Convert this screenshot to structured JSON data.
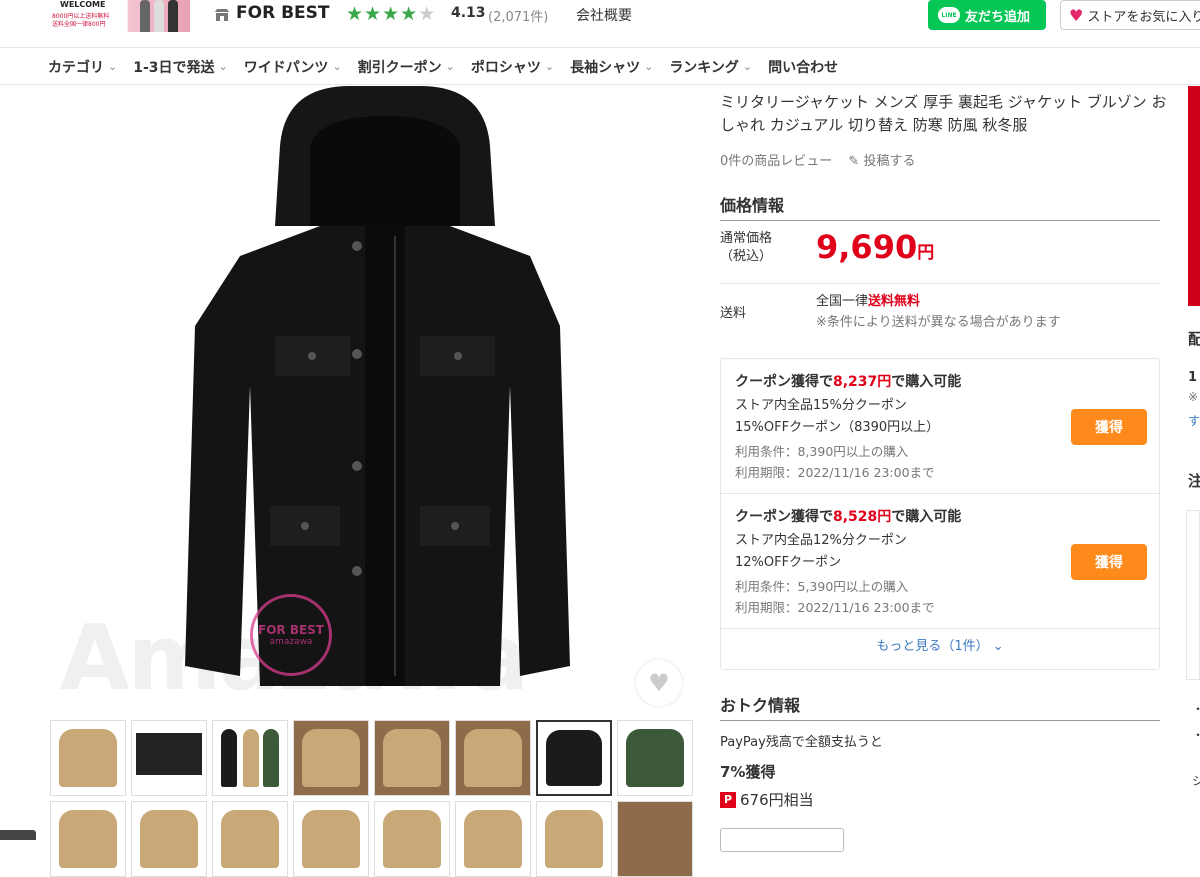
{
  "header": {
    "banner": {
      "title": "WELCOME",
      "line1": "8000円以上送料無料",
      "line2": "送料全国一律800円"
    },
    "store_name": "FOR BEST",
    "rating": "4.13",
    "rating_count": "(2,071件)",
    "rating_stars": 4,
    "company_link": "会社概要",
    "line_button": "友だち追加",
    "line_icon_text": "LINE",
    "fav_button": "ストアをお気に入り"
  },
  "nav": {
    "items": [
      "カテゴリ",
      "1-3日で発送",
      "ワイドパンツ",
      "割引クーポン",
      "ポロシャツ",
      "長袖シャツ",
      "ランキング",
      "問い合わせ"
    ]
  },
  "image": {
    "watermark": "Amazawa",
    "stamp_brand": "FOR BEST",
    "stamp_sub": "amazawa"
  },
  "product": {
    "title": "ミリタリージャケット メンズ 厚手 裏起毛 ジャケット ブルゾン おしゃれ カジュアル 切り替え 防寒 防風 秋冬服",
    "reviews": "0件の商品レビュー",
    "post_review": "投稿する"
  },
  "price": {
    "heading": "価格情報",
    "label_line1": "通常価格",
    "label_line2": "（税込）",
    "value": "9,690",
    "unit": "円",
    "shipping_label": "送料",
    "shipping_prefix": "全国一律",
    "shipping_free": "送料無料",
    "shipping_note": "※条件により送料が異なる場合があります"
  },
  "coupons": [
    {
      "head_prefix": "クーポン獲得で",
      "head_price": "8,237円",
      "head_suffix": "で購入可能",
      "line1": "ストア内全品15%分クーポン",
      "line2": "15%OFFクーポン（8390円以上）",
      "cond1": "利用条件：8,390円以上の購入",
      "cond2": "利用期限：2022/11/16 23:00まで",
      "button": "獲得"
    },
    {
      "head_prefix": "クーポン獲得で",
      "head_price": "8,528円",
      "head_suffix": "で購入可能",
      "line1": "ストア内全品12%分クーポン",
      "line2": "12%OFFクーポン",
      "cond1": "利用条件：5,390円以上の購入",
      "cond2": "利用期限：2022/11/16 23:00まで",
      "button": "獲得"
    }
  ],
  "more_link": "もっと見る（1件）",
  "deals": {
    "heading": "おトク情報",
    "paypay": "PayPay残高で全額支払うと",
    "percent": "7%獲得",
    "points": "676円相当",
    "points_icon": "P"
  },
  "side": {
    "h1": "配",
    "h2": "1",
    "h3": "※",
    "h4": "す",
    "h5": "注",
    "dot1": "・",
    "dot2": "・",
    "dot3": "シ"
  },
  "colors": {
    "accent_red": "#e0001a",
    "orange_button": "#ff8a1c",
    "line_green": "#06c755",
    "star_green": "#3aa94a",
    "link_blue": "#3d7ac1"
  }
}
